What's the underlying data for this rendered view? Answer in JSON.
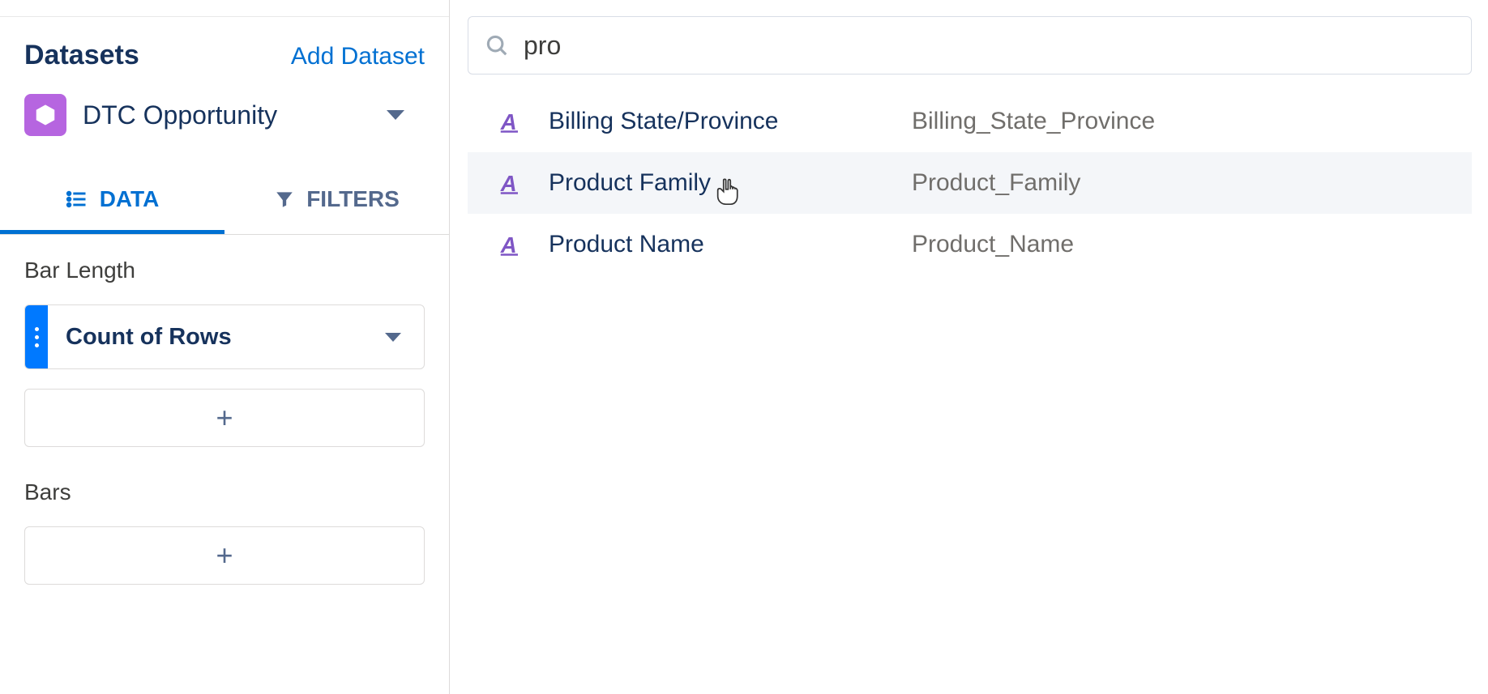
{
  "sidebar": {
    "datasets_title": "Datasets",
    "add_dataset_label": "Add Dataset",
    "selected_dataset": "DTC Opportunity",
    "tabs": {
      "data": "DATA",
      "filters": "FILTERS"
    },
    "bar_length_label": "Bar Length",
    "bar_length_field": "Count of Rows",
    "bars_label": "Bars",
    "add_button_glyph": "+"
  },
  "search": {
    "value": "pro"
  },
  "results": [
    {
      "label": "Billing State/Province",
      "api": "Billing_State_Province"
    },
    {
      "label": "Product Family",
      "api": "Product_Family"
    },
    {
      "label": "Product Name",
      "api": "Product_Name"
    }
  ]
}
